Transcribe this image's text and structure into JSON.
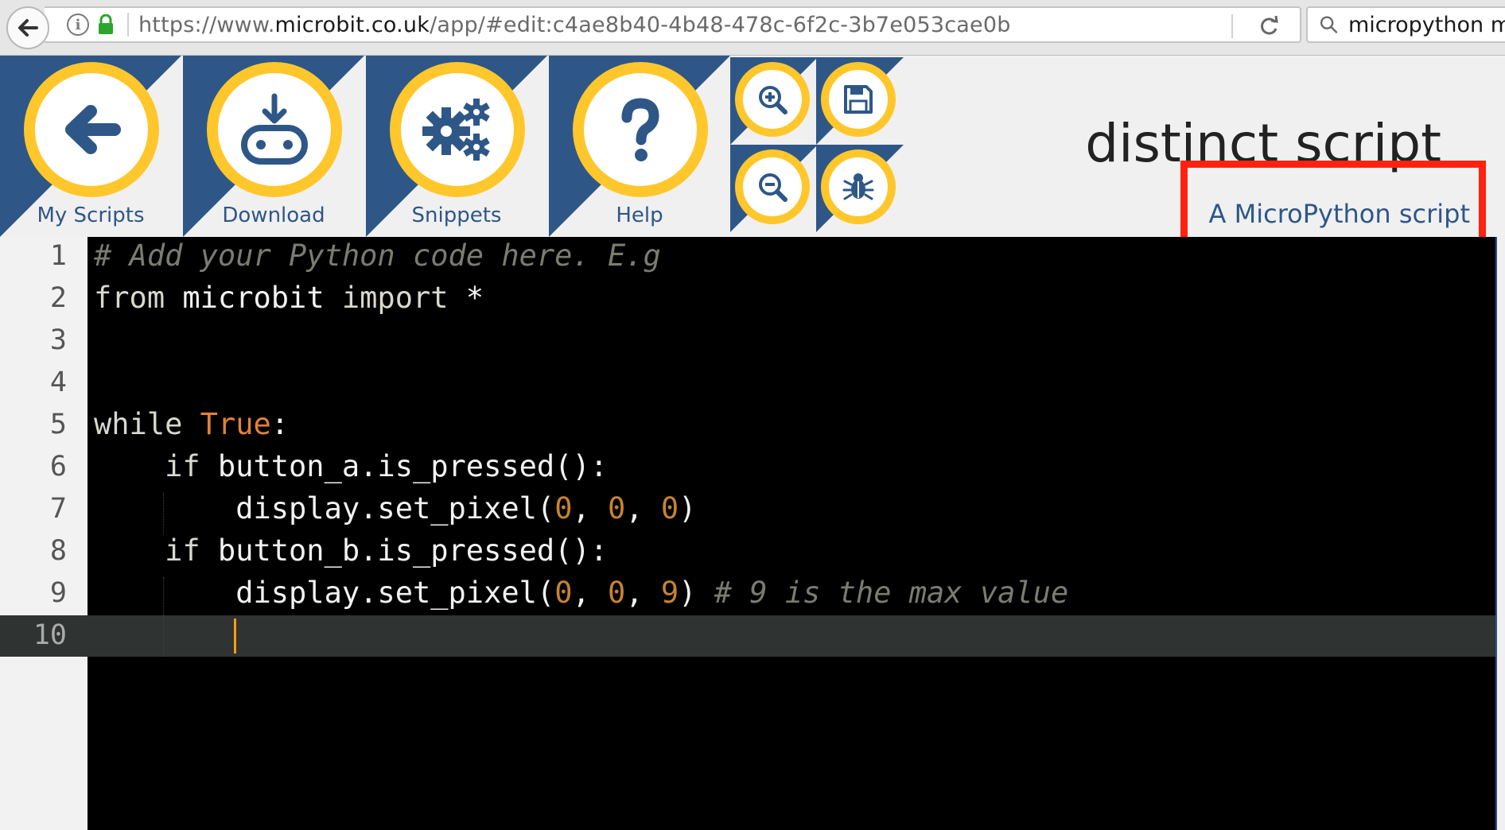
{
  "browser": {
    "url_prefix": "https://www.",
    "url_domain": "microbit.co.uk",
    "url_rest": "/app/#edit:c4ae8b40-4b48-478c-6f2c-3b7e053cae0b",
    "search_text": "micropython m"
  },
  "toolbar": {
    "my_scripts_label": "My Scripts",
    "download_label": "Download",
    "snippets_label": "Snippets",
    "help_label": "Help"
  },
  "script": {
    "title": "distinct script",
    "description": "A MicroPython script"
  },
  "editor": {
    "line_numbers": [
      "1",
      "2",
      "3",
      "4",
      "5",
      "6",
      "7",
      "8",
      "9",
      "10"
    ],
    "active_line": "10",
    "lines": {
      "l1_comment": "# Add your Python code here. E.g",
      "l2_from": "from",
      "l2_module": " microbit ",
      "l2_import": "import",
      "l2_star": " *",
      "l5_while": "while",
      "l5_true": " True",
      "l5_colon": ":",
      "l6_if": "    if",
      "l6_rest": " button_a.is_pressed():",
      "l7_call": "        display.set_pixel(",
      "l7_a": "0",
      "l7_sep1": ", ",
      "l7_b": "0",
      "l7_sep2": ", ",
      "l7_c": "0",
      "l7_close": ")",
      "l8_if": "    if",
      "l8_rest": " button_b.is_pressed():",
      "l9_call": "        display.set_pixel(",
      "l9_a": "0",
      "l9_sep1": ", ",
      "l9_b": "0",
      "l9_sep2": ", ",
      "l9_c": "9",
      "l9_close": ") ",
      "l9_comment": "# 9 is the max value"
    }
  },
  "colors": {
    "brand_blue": "#2e5788",
    "brand_yellow": "#ffc72c",
    "highlight_red": "#ff2211"
  },
  "icons": {
    "back": "arrow-left-icon",
    "download": "microbit-download-icon",
    "snippets": "gears-icon",
    "help": "question-icon",
    "zoom_in": "zoom-in-icon",
    "zoom_out": "zoom-out-icon",
    "save": "save-icon",
    "debug": "bug-icon"
  }
}
